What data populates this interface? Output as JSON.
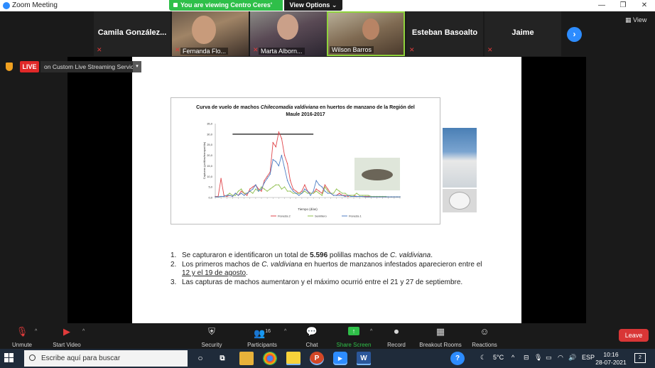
{
  "window": {
    "title": "Zoom Meeting",
    "minimize": "—",
    "restore": "❐",
    "close": "✕"
  },
  "share_banner": {
    "text": "You are viewing Centro Ceres' screen",
    "view_options": "View Options ⌄"
  },
  "participants": [
    {
      "name": "Camila  González...",
      "has_video": false
    },
    {
      "name": "Fernanda Flo...",
      "has_video": true
    },
    {
      "name": "Marta Alborn...",
      "has_video": true
    },
    {
      "name": "Wilson Barros",
      "has_video": true
    },
    {
      "name": "Esteban Basoalto",
      "has_video": false
    },
    {
      "name": "Jaime",
      "has_video": false
    }
  ],
  "gallery": {
    "next_glyph": "›",
    "view_label": "▦ View"
  },
  "live": {
    "badge": "LIVE",
    "service": "on Custom Live Streaming Service",
    "caret": "▾"
  },
  "slide": {
    "findings": [
      {
        "num": "1.",
        "parts": [
          {
            "t": "Se capturaron e identificaron un total de ",
            "s": ""
          },
          {
            "t": "5.596",
            "s": "b"
          },
          {
            "t": " polillas machos de ",
            "s": ""
          },
          {
            "t": "C. valdiviana",
            "s": "i"
          },
          {
            "t": ".",
            "s": ""
          }
        ]
      },
      {
        "num": "2.",
        "parts": [
          {
            "t": "Los primeros machos de ",
            "s": ""
          },
          {
            "t": "C. valdiviana",
            "s": "i"
          },
          {
            "t": " en huertos de manzanos infestados aparecieron entre el ",
            "s": ""
          },
          {
            "t": "12 y el 19 de agosto",
            "s": "u"
          },
          {
            "t": ".",
            "s": ""
          }
        ]
      },
      {
        "num": "3.",
        "parts": [
          {
            "t": "Las capturas de machos aumentaron y el máximo ocurrió entre el 21 y 27 de septiembre.",
            "s": ""
          }
        ]
      }
    ]
  },
  "chart_data": {
    "type": "line",
    "title_prefix": "Curva de vuelo de machos ",
    "title_species": "Chilecomadia valdiviana",
    "title_suffix": " en huertos de manzano de la Región del Maule 2016-2017",
    "ylabel": "Capturas (polillas/trampa/día)",
    "xlabel": "Tiempo (días)",
    "ylim": [
      0,
      35
    ],
    "yticks": [
      "0,0",
      "5,0",
      "10,0",
      "15,0",
      "20,0",
      "25,0",
      "30,0",
      "35,0"
    ],
    "n_points": 65,
    "legend_position": "bottom",
    "series": [
      {
        "name": "Floresta 2",
        "color": "#e0474c",
        "values": [
          0.5,
          0.5,
          9,
          1,
          0.5,
          1,
          0.5,
          2,
          1,
          3,
          2,
          1,
          4,
          5,
          6,
          4,
          3,
          8,
          10,
          12,
          26,
          24,
          31,
          28,
          20,
          16,
          8,
          4,
          3,
          2,
          3,
          6,
          3,
          2,
          2,
          4,
          3,
          2,
          6,
          4,
          2,
          1,
          1,
          2,
          1,
          1,
          0.5,
          1,
          1,
          0.5,
          0.5,
          0.5,
          0.5,
          0.5,
          0.5,
          0.3,
          0.3,
          0.3,
          0.3,
          0.3,
          0.3,
          0.3,
          0.3,
          0.3,
          0.3
        ]
      },
      {
        "name": "Semillero",
        "color": "#8fbf4d",
        "values": [
          0.3,
          0.3,
          0.5,
          0.5,
          1,
          2,
          1,
          1,
          3,
          4,
          2,
          2,
          3,
          2,
          4,
          3,
          5,
          4,
          3,
          4,
          5,
          6,
          6,
          4,
          5,
          3,
          3,
          2,
          2,
          2,
          2,
          3,
          2,
          2,
          2,
          3,
          2,
          1,
          5,
          3,
          2,
          2,
          4,
          3,
          2,
          2,
          1,
          1,
          1,
          2,
          1,
          1,
          1,
          1,
          0.5,
          0.5,
          0.5,
          0.5,
          0.5,
          0.5,
          0.3,
          0.3,
          0.3,
          0.3,
          0.3
        ]
      },
      {
        "name": "Floresta 1",
        "color": "#4f7fc4",
        "values": [
          0.3,
          0.3,
          0.5,
          0.5,
          1,
          1,
          0.5,
          2,
          1,
          2,
          1,
          2,
          3,
          4,
          6,
          3,
          4,
          7,
          9,
          11,
          18,
          17,
          15,
          20,
          14,
          8,
          5,
          3,
          2,
          1,
          2,
          4,
          3,
          1,
          3,
          8,
          6,
          5,
          3,
          2,
          2,
          1,
          1,
          1,
          1,
          0.5,
          1,
          0.5,
          0.5,
          0.5,
          0.5,
          0.5,
          0.3,
          0.3,
          0.3,
          0.3,
          0.3,
          0.3,
          0.3,
          0.3,
          0.3,
          0.3,
          0.3,
          0.3,
          0.3
        ]
      }
    ]
  },
  "toolbar": {
    "unmute": "Unmute",
    "start_video": "Start Video",
    "security": "Security",
    "participants": "Participants",
    "participants_count": "16",
    "chat": "Chat",
    "share_screen": "Share Screen",
    "record": "Record",
    "breakout_rooms": "Breakout Rooms",
    "reactions": "Reactions",
    "leave": "Leave",
    "caret": "^"
  },
  "taskbar": {
    "search_placeholder": "Escribe aquí para buscar",
    "temperature": "5°C",
    "language": "ESP",
    "time": "10:16",
    "date": "28-07-2021",
    "notifications": "2"
  }
}
